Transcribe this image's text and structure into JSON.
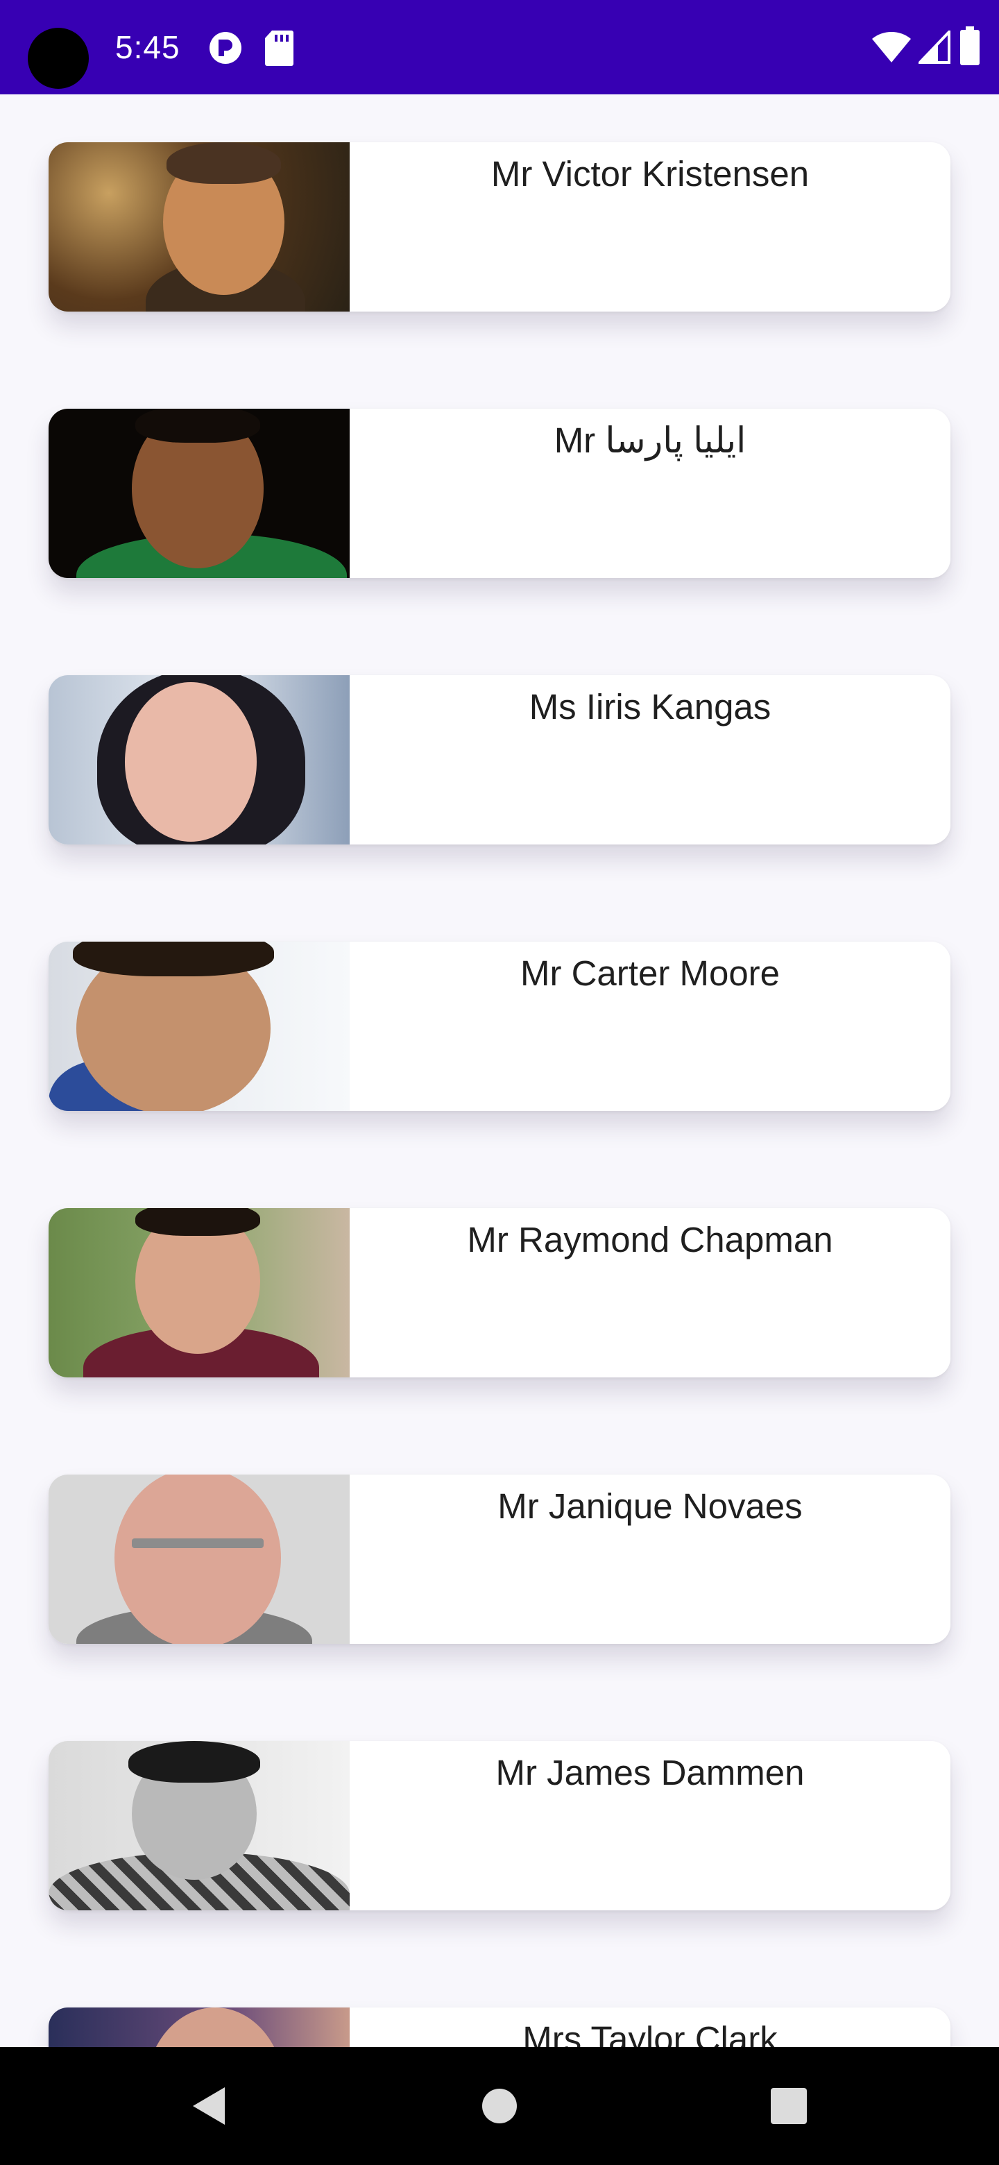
{
  "status_bar": {
    "time": "5:45",
    "background_color": "#3700b3",
    "icons": [
      "app-notification-icon",
      "sd-card-icon",
      "wifi-icon",
      "cell-signal-icon",
      "battery-icon"
    ]
  },
  "people": [
    {
      "name": "Mr Victor Kristensen",
      "avatar_desc": "man-portrait"
    },
    {
      "name": "Mr ایلیا پارسا",
      "avatar_desc": "man-portrait"
    },
    {
      "name": "Ms Iiris Kangas",
      "avatar_desc": "woman-portrait"
    },
    {
      "name": "Mr Carter Moore",
      "avatar_desc": "man-portrait"
    },
    {
      "name": "Mr Raymond Chapman",
      "avatar_desc": "man-portrait"
    },
    {
      "name": "Mr Janique Novaes",
      "avatar_desc": "man-portrait"
    },
    {
      "name": "Mr James Dammen",
      "avatar_desc": "man-portrait"
    },
    {
      "name": "Mrs Taylor Clark",
      "avatar_desc": "woman-portrait"
    }
  ],
  "nav_bar": {
    "buttons": [
      "back-icon",
      "home-icon",
      "recents-icon"
    ]
  }
}
